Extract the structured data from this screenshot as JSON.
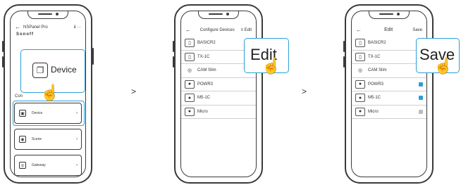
{
  "arrows": {
    "first": ">",
    "second": ">"
  },
  "phone1": {
    "header_title": "NSPanel Pro",
    "header_icons": "ℹ ···",
    "brand": "Sonoff",
    "section_label": "Con",
    "callout_label": "Device",
    "cards": [
      {
        "label": "Device",
        "icon": "device-icon"
      },
      {
        "label": "Scene",
        "icon": "scene-icon"
      },
      {
        "label": "Gateway",
        "icon": "gateway-icon"
      }
    ],
    "accent_color": "#2a9fd8"
  },
  "phone2": {
    "header_title": "Configure Devices",
    "header_action": "Edit",
    "callout_label": "Edit",
    "rows": [
      "BASICR2",
      "TX-1C",
      "CAM Slim",
      "POWR3",
      "M5-1C",
      "Micro"
    ]
  },
  "phone3": {
    "header_title": "Edit",
    "header_action": "Save",
    "callout_label": "Save",
    "rows": [
      {
        "label": "BASICR2",
        "checked": null
      },
      {
        "label": "TX-1C",
        "checked": null
      },
      {
        "label": "CAM Slim",
        "checked": null
      },
      {
        "label": "POWR3",
        "checked": true
      },
      {
        "label": "M5-1C",
        "checked": true
      },
      {
        "label": "Micro",
        "checked": false
      }
    ]
  }
}
